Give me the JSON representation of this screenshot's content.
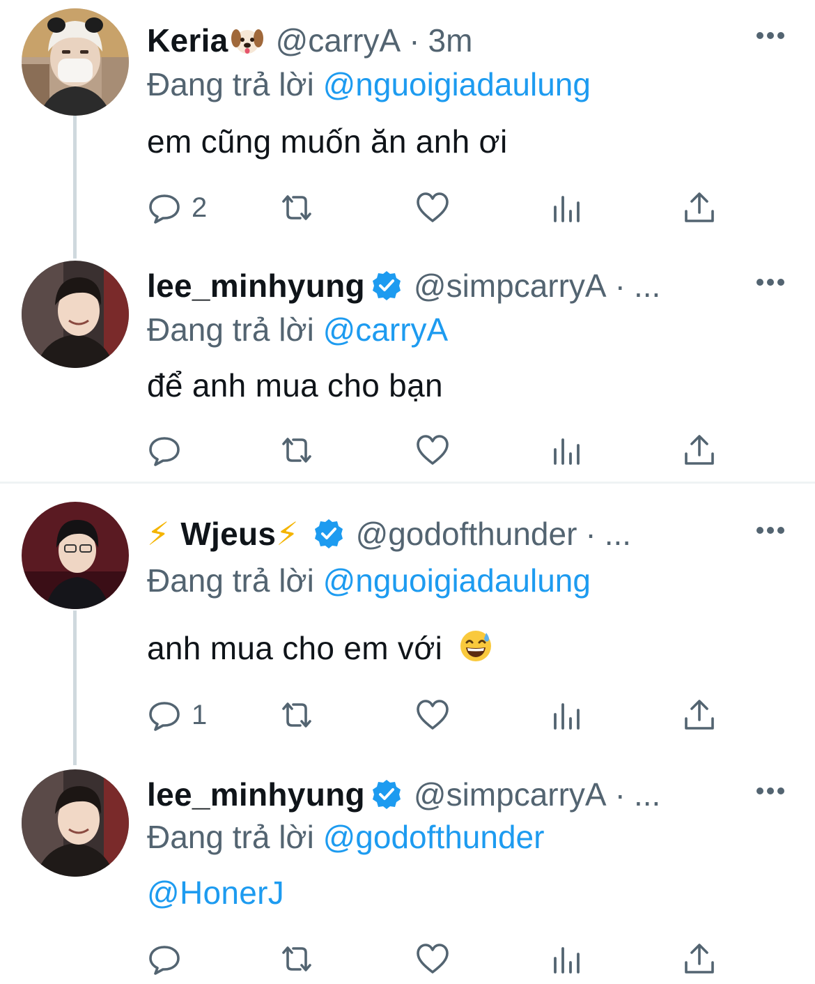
{
  "tweets": [
    {
      "name": "Keria",
      "name_emoji": "dog-face-icon",
      "handle": "@carryA",
      "separator": "·",
      "time": "3m",
      "reply_prefix": "Đang trả lời",
      "reply_to": "@nguoigiadaulung",
      "text": "em cũng muốn ăn anh ơi",
      "reply_count": "2",
      "verified": false
    },
    {
      "name": "lee_minhyung",
      "handle": "@simpcarryA",
      "separator": "·",
      "time": "...",
      "reply_prefix": "Đang trả lời",
      "reply_to": "@carryA",
      "text": "để anh mua cho bạn",
      "reply_count": "",
      "verified": true
    },
    {
      "name_prefix": "⚡",
      "name": "Wjeus",
      "name_suffix": "⚡",
      "handle": "@godofthunder",
      "separator": "·",
      "time": "...",
      "reply_prefix": "Đang trả lời",
      "reply_to": "@nguoigiadaulung",
      "text": "anh mua cho em với",
      "text_emoji": "grinning-sweat-emoji",
      "reply_count": "1",
      "verified": true
    },
    {
      "name": "lee_minhyung",
      "handle": "@simpcarryA",
      "separator": "·",
      "time": "...",
      "reply_prefix": "Đang trả lời",
      "reply_to": "@godofthunder",
      "text": "@HonerJ",
      "reply_count": "",
      "verified": true
    }
  ],
  "colors": {
    "accent": "#1d9bf0",
    "secondary_text": "#536471",
    "primary_text": "#0f1419",
    "thread_line": "#cfd9de"
  }
}
